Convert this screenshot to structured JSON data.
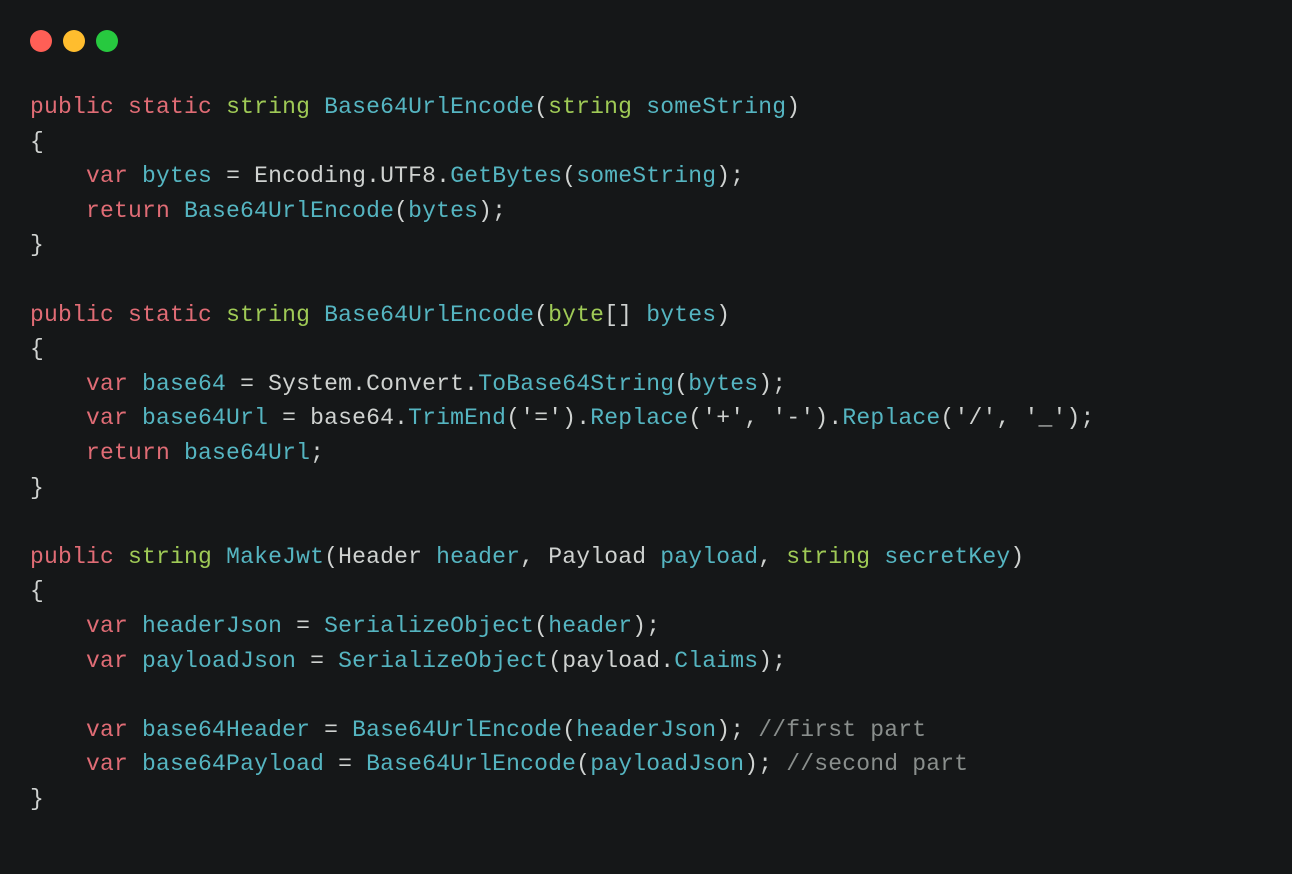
{
  "titlebar": {
    "close": "close",
    "minimize": "minimize",
    "maximize": "maximize"
  },
  "tokens": {
    "public": "public",
    "static": "static",
    "string": "string",
    "byte": "byte",
    "var": "var",
    "return": "return",
    "Base64UrlEncode": "Base64UrlEncode",
    "MakeJwt": "MakeJwt",
    "someString": "someString",
    "bytes": "bytes",
    "base64": "base64",
    "base64Url": "base64Url",
    "header": "header",
    "payload": "payload",
    "secretKey": "secretKey",
    "headerJson": "headerJson",
    "payloadJson": "payloadJson",
    "base64Header": "base64Header",
    "base64Payload": "base64Payload",
    "Encoding": "Encoding",
    "UTF8": "UTF8",
    "GetBytes": "GetBytes",
    "System": "System",
    "Convert": "Convert",
    "ToBase64String": "ToBase64String",
    "TrimEnd": "TrimEnd",
    "Replace": "Replace",
    "SerializeObject": "SerializeObject",
    "Claims": "Claims",
    "Header": "Header",
    "Payload": "Payload",
    "brackets": "[]",
    "open_paren": "(",
    "close_paren": ")",
    "open_brace": "{",
    "close_brace": "}",
    "semicolon": ";",
    "dot": ".",
    "comma": ",",
    "equals": "=",
    "sp": " ",
    "indent": "    ",
    "str_eq": "'='",
    "str_plus": "'+'",
    "str_dash": "'-'",
    "str_slash": "'/'",
    "str_underscore": "'_'",
    "comment_first": "//first part",
    "comment_second": "//second part"
  }
}
